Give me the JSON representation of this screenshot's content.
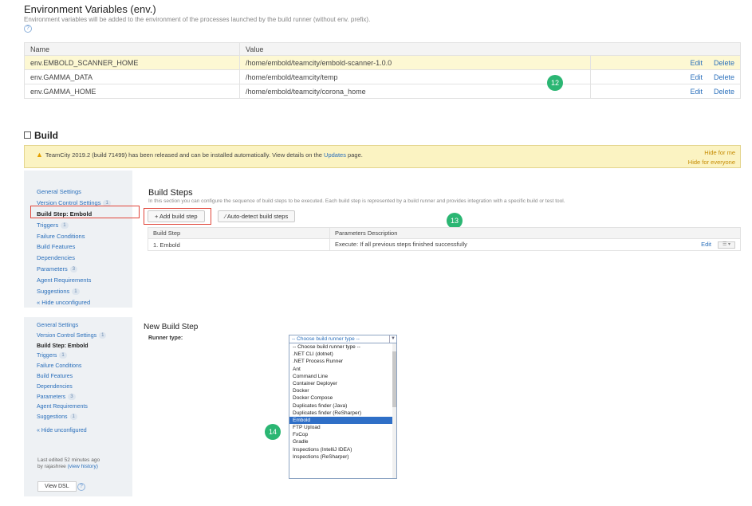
{
  "env": {
    "title": "Environment Variables (env.)",
    "description": "Environment variables will be added to the environment of the processes launched by the build runner (without env. prefix).",
    "help": "?",
    "columns": [
      "Name",
      "Value"
    ],
    "rows": [
      {
        "name": "env.EMBOLD_SCANNER_HOME",
        "value": "/home/embold/teamcity/embold-scanner-1.0.0",
        "edit": "Edit",
        "delete": "Delete"
      },
      {
        "name": "env.GAMMA_DATA",
        "value": "/home/embold/teamcity/temp",
        "edit": "Edit",
        "delete": "Delete"
      },
      {
        "name": "env.GAMMA_HOME",
        "value": "/home/embold/teamcity/corona_home",
        "edit": "Edit",
        "delete": "Delete"
      }
    ]
  },
  "badges": {
    "b12": "12",
    "b13": "13",
    "b14": "14"
  },
  "build": {
    "title": "Build"
  },
  "warning": {
    "text_before": "TeamCity 2019.2 (build 71499) has been released and can be installed automatically. View details on the ",
    "link": "Updates",
    "text_after": " page.",
    "hide_me": "Hide for me",
    "hide_all": "Hide for everyone"
  },
  "sidebar": {
    "items": [
      {
        "label": "General Settings",
        "count": ""
      },
      {
        "label": "Version Control Settings",
        "count": "1"
      },
      {
        "label": "Build Step: Embold",
        "count": ""
      },
      {
        "label": "Triggers",
        "count": "1"
      },
      {
        "label": "Failure Conditions",
        "count": ""
      },
      {
        "label": "Build Features",
        "count": ""
      },
      {
        "label": "Dependencies",
        "count": ""
      },
      {
        "label": "Parameters",
        "count": "3"
      },
      {
        "label": "Agent Requirements",
        "count": ""
      },
      {
        "label": "Suggestions",
        "count": "1"
      },
      {
        "label": "« Hide unconfigured",
        "count": ""
      }
    ],
    "last_edited": "Last edited 52 minutes ago",
    "by": "by rajashree",
    "view_history": "(view history)",
    "view_dsl": "View DSL"
  },
  "build_steps": {
    "title": "Build Steps",
    "description": "In this section you can configure the sequence of build steps to be executed. Each build step is represented by a build runner and provides integration with a specific build or test tool.",
    "add_label": "+ Add build step",
    "auto_label": "⁄ Auto-detect build steps",
    "columns": [
      "Build Step",
      "Parameters Description"
    ],
    "rows": [
      {
        "step": "1. Embold",
        "params": "Execute: If all previous steps finished successfully",
        "edit": "Edit"
      }
    ]
  },
  "new_step": {
    "title": "New Build Step",
    "runner_label": "Runner type:",
    "selected": "-- Choose build runner type --",
    "options": [
      "-- Choose build runner type --",
      ".NET CLI (dotnet)",
      ".NET Process Runner",
      "Ant",
      "Command Line",
      "Container Deployer",
      "Docker",
      "Docker Compose",
      "Duplicates finder (Java)",
      "Duplicates finder (ReSharper)",
      "Embold",
      "FTP Upload",
      "FxCop",
      "Gradle",
      "Inspections (IntelliJ IDEA)",
      "Inspections (ReSharper)"
    ],
    "highlighted_option": "Embold"
  }
}
